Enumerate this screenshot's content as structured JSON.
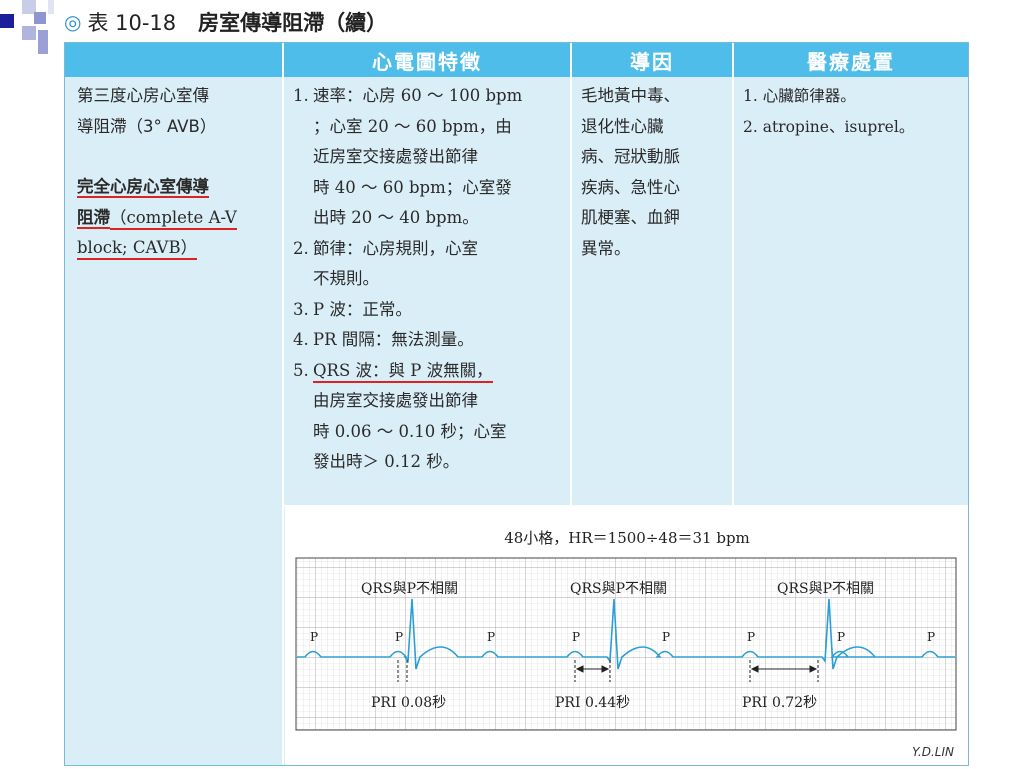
{
  "title": {
    "bullet_icon": "circle-bullet-icon",
    "number": "表 10-18",
    "text": "房室傳導阻滯（續）"
  },
  "columns": [
    "心電圖特徵",
    "導因",
    "醫療處置"
  ],
  "row": {
    "name_lines": [
      "第三度心房心室傳",
      "導阻滯（3° AVB）"
    ],
    "name_emph_1": "完全心房心室傳導",
    "name_emph_2": "阻滯",
    "name_en_1": "（complete A-V",
    "name_en_2": "block; CAVB）",
    "ecg_features": [
      {
        "num": "1.",
        "lines": [
          "速率：心房 60 ～ 100 bpm",
          "；心室 20 ～ 60 bpm，由",
          "近房室交接處發出節律",
          "時 40 ～ 60 bpm；心室發",
          "出時 20 ～ 40 bpm。"
        ]
      },
      {
        "num": "2.",
        "lines": [
          "節律：心房規則，心室",
          "不規則。"
        ]
      },
      {
        "num": "3.",
        "lines": [
          "P 波：正常。"
        ]
      },
      {
        "num": "4.",
        "lines": [
          "PR 間隔：無法測量。"
        ]
      },
      {
        "num": "5.",
        "lines": [
          "QRS 波：與 P 波無關，",
          "由房室交接處發出節律",
          "時 0.06 ～ 0.10 秒；心室",
          "發出時＞ 0.12 秒。"
        ]
      }
    ],
    "causes": [
      "毛地黃中毒、",
      "退化性心臟",
      "病、冠狀動脈",
      "疾病、急性心",
      "肌梗塞、血鉀",
      "異常。"
    ],
    "treatment": [
      "1. 心臟節律器。",
      "2. atropine、isuprel。"
    ]
  },
  "ecg": {
    "caption": "48小格，HR＝1500÷48＝31 bpm",
    "qrs_labels": [
      "QRS與P不相關",
      "QRS與P不相關",
      "QRS與P不相關"
    ],
    "p_label": "P",
    "pri_labels": [
      "PRI 0.08秒",
      "PRI 0.44秒",
      "PRI 0.72秒"
    ],
    "signature": "Y.D.LIN",
    "trace_color": "#2a9fd6"
  }
}
